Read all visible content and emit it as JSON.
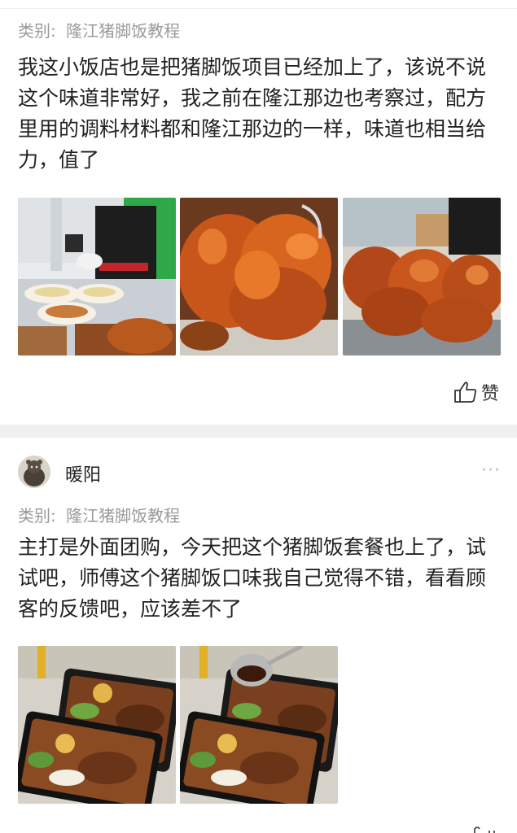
{
  "posts": [
    {
      "category_label": "类别:",
      "category": "隆江猪脚饭教程",
      "text": "我这小饭店也是把猪脚饭项目已经加上了，该说不说这个味道非常好，我之前在隆江那边也考察过，配方里用的调料材料都和隆江那边的一样，味道也相当给力，值了",
      "like_label": "赞",
      "photos": [
        "chef-plating-photo",
        "braised-pork-trotter-closeup-photo",
        "pork-trotters-tray-photo"
      ]
    },
    {
      "username": "暖阳",
      "category_label": "类别:",
      "category": "隆江猪脚饭教程",
      "text": "主打是外面团购，今天把这个猪脚饭套餐也上了，试试吧，师傅这个猪脚饭口味我自己觉得不错，看看顾客的反馈吧，应该差不了",
      "more": "···",
      "photos": [
        "pork-trotter-rice-boxes-photo",
        "pork-trotter-rice-sauce-photo"
      ]
    }
  ],
  "colors": {
    "meta_text": "#9a9a9a",
    "body_text": "#222222",
    "separator": "#f0f0f0"
  }
}
